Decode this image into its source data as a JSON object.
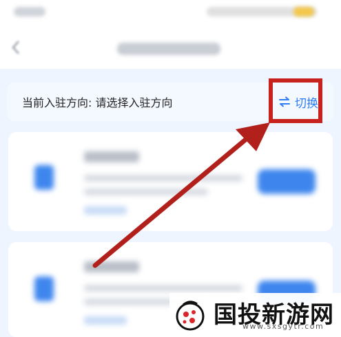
{
  "direction": {
    "label": "当前入驻方向: 请选择入驻方向",
    "switch_label": "切换"
  },
  "watermark": {
    "brand": "国投新游网",
    "url": "www.sxsgytr.com"
  },
  "colors": {
    "accent": "#2f7df6",
    "highlight": "#c8221e",
    "background": "#eef5ff"
  },
  "icons": {
    "switch": "swap-arrows-icon",
    "back": "chevron-left-icon"
  }
}
